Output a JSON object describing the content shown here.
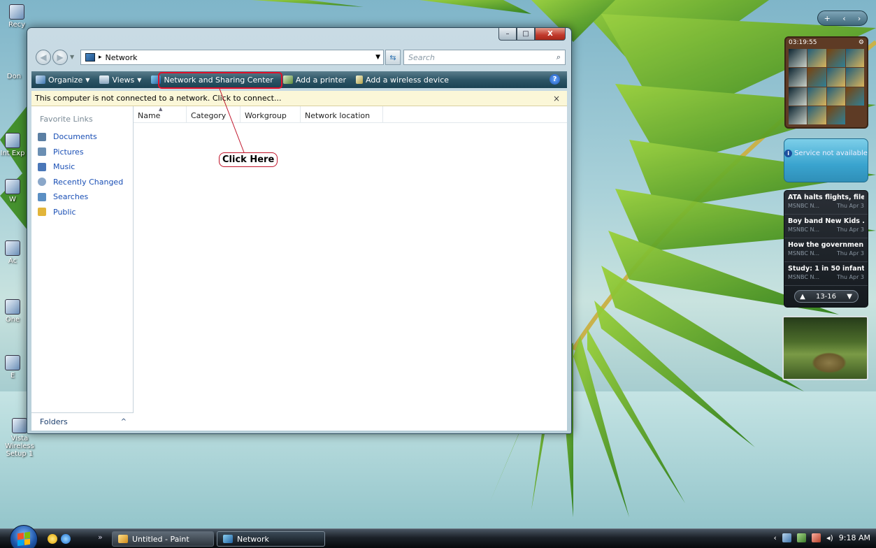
{
  "desktop": {
    "icons": [
      {
        "label": "Recy"
      },
      {
        "label": "Don"
      },
      {
        "label": "Int Exp"
      },
      {
        "label": "W"
      },
      {
        "label": "Ac"
      },
      {
        "label": "One"
      },
      {
        "label": "E"
      },
      {
        "label": "Vista Wireless Setup 1"
      }
    ]
  },
  "window": {
    "title_buttons": {
      "minimize": "–",
      "maximize": "□",
      "close": "X"
    },
    "address": {
      "location": "Network",
      "crumb_separator": "▸"
    },
    "search": {
      "placeholder": "Search"
    },
    "toolbar": {
      "organize": "Organize",
      "views": "Views",
      "network_sharing": "Network and Sharing Center",
      "add_printer": "Add a printer",
      "add_wireless": "Add a wireless device",
      "help": "?"
    },
    "infobar": {
      "message": "This computer is not connected to a network. Click to connect...",
      "close": "×"
    },
    "favorites": {
      "title": "Favorite Links",
      "items": [
        {
          "label": "Documents",
          "color": "#5b7fa3"
        },
        {
          "label": "Pictures",
          "color": "#6b8fb3"
        },
        {
          "label": "Music",
          "color": "#4a77b8"
        },
        {
          "label": "Recently Changed",
          "color": "#8aa7c9"
        },
        {
          "label": "Searches",
          "color": "#5b8fc3"
        },
        {
          "label": "Public",
          "color": "#e2b53a"
        }
      ]
    },
    "folders_label": "Folders",
    "columns": [
      "Name",
      "Category",
      "Workgroup",
      "Network location"
    ],
    "callout": "Click Here",
    "highlight_color": "#e0102a"
  },
  "sidebar": {
    "controls": {
      "add": "+",
      "prev": "‹",
      "next": "›"
    },
    "puzzle": {
      "time": "03:19:55"
    },
    "weather": {
      "status": "Service not available"
    },
    "news": {
      "items": [
        {
          "headline": "ATA halts flights, file...",
          "source": "MSNBC N...",
          "date": "Thu Apr 3"
        },
        {
          "headline": "Boy band New Kids ...",
          "source": "MSNBC N...",
          "date": "Thu Apr 3"
        },
        {
          "headline": "How the governmen...",
          "source": "MSNBC N...",
          "date": "Thu Apr 3"
        },
        {
          "headline": "Study: 1 in 50 infants...",
          "source": "MSNBC N...",
          "date": "Thu Apr 3"
        }
      ],
      "pager": "13-16"
    }
  },
  "taskbar": {
    "more": "»",
    "buttons": [
      {
        "label": "Untitled - Paint"
      },
      {
        "label": "Network"
      }
    ],
    "clock": "9:18 AM"
  }
}
